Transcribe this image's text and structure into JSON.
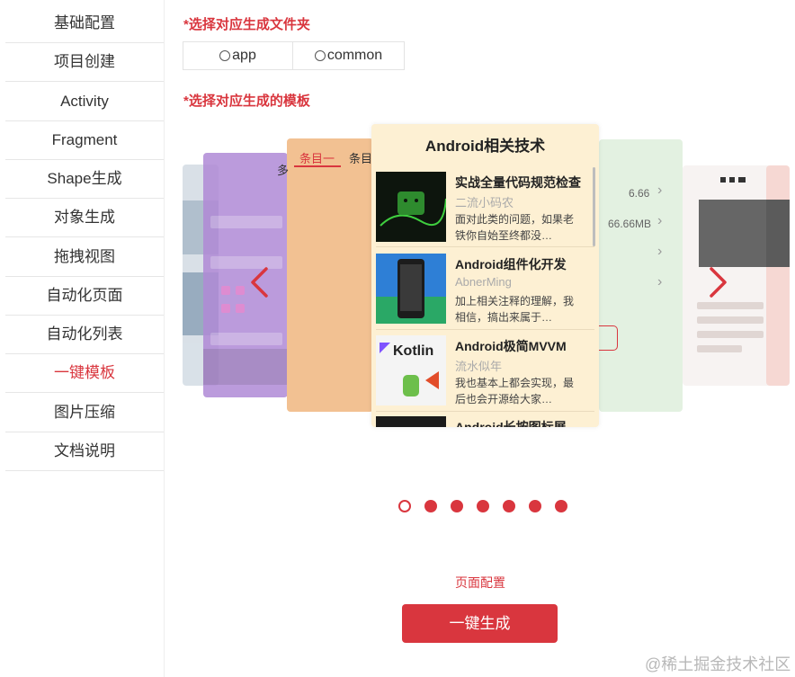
{
  "sidebar": {
    "items": [
      {
        "label": "基础配置"
      },
      {
        "label": "项目创建"
      },
      {
        "label": "Activity"
      },
      {
        "label": "Fragment"
      },
      {
        "label": "Shape生成"
      },
      {
        "label": "对象生成"
      },
      {
        "label": "拖拽视图"
      },
      {
        "label": "自动化页面"
      },
      {
        "label": "自动化列表"
      },
      {
        "label": "一键模板",
        "active": true
      },
      {
        "label": "图片压缩"
      },
      {
        "label": "文档说明"
      }
    ]
  },
  "folder_section": {
    "label": "*选择对应生成文件夹",
    "options": [
      "app",
      "common"
    ]
  },
  "template_section": {
    "label": "*选择对应生成的模板"
  },
  "carousel": {
    "left_card": {
      "tab_active": "条目一",
      "tab_next": "条目",
      "stray_text": "多"
    },
    "right_card": {
      "value1": "6.66",
      "value2": "66.66MB"
    },
    "center_card": {
      "title": "Android相关技术",
      "items": [
        {
          "title": "实战全量代码规范检查",
          "author": "二流小码农",
          "desc": "面对此类的问题，如果老铁你自始至终都没…",
          "thumb": "android-code-thumb"
        },
        {
          "title": "Android组件化开发",
          "author": "AbnerMing",
          "desc": "加上相关注释的理解，我相信，搞出来属于…",
          "thumb": "phone-thumb"
        },
        {
          "title": "Android极简MVVM",
          "author": "流水似年",
          "desc": "我也基本上都会实现，最后也会开源给大家…",
          "thumb": "kotlin-thumb"
        },
        {
          "title": "Android长按图标展",
          "author": "",
          "desc": "",
          "thumb": "dark-thumb"
        }
      ]
    },
    "dots_total": 7,
    "dots_active_index": 0
  },
  "actions": {
    "page_config": "页面配置",
    "generate": "一键生成"
  },
  "watermark": "@稀土掘金技术社区",
  "colors": {
    "accent": "#d9363e"
  }
}
